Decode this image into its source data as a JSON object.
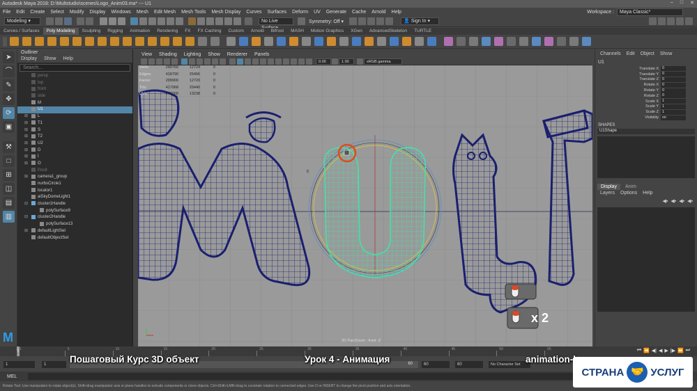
{
  "window": {
    "title": "Autodesk Maya 2018: D:\\Multstudio\\scenes\\Logo_Anim03.ma*  ---  U1",
    "controls": [
      "–",
      "□",
      "✕"
    ]
  },
  "menubar": {
    "items": [
      "File",
      "Edit",
      "Create",
      "Select",
      "Modify",
      "Display",
      "Windows",
      "Mesh",
      "Edit Mesh",
      "Mesh Tools",
      "Mesh Display",
      "Curves",
      "Surfaces",
      "Deform",
      "UV",
      "Generate",
      "Cache",
      "Arnold",
      "Help"
    ],
    "workspace_label": "Workspace :",
    "workspace_value": "Maya Classic*"
  },
  "statusline": {
    "mode": "Modeling",
    "live_surface": "No Live Surface",
    "symmetry": "Symmetry: Off",
    "signin": "Sign In"
  },
  "shelf": {
    "tabs": [
      "Curves / Surfaces",
      "Poly Modeling",
      "Sculpting",
      "Rigging",
      "Animation",
      "Rendering",
      "FX",
      "FX Caching",
      "Custom",
      "Arnold",
      "Bifrost",
      "MASH",
      "Motion Graphics",
      "XGen",
      "AdvancedSkeleton",
      "TURTLE"
    ],
    "active_tab": 1
  },
  "outliner": {
    "title": "Outliner",
    "menu": [
      "Display",
      "Show",
      "Help"
    ],
    "search_placeholder": "Search...",
    "items": [
      {
        "label": "persp",
        "dim": true,
        "exp": ""
      },
      {
        "label": "top",
        "dim": true,
        "exp": ""
      },
      {
        "label": "front",
        "dim": true,
        "exp": ""
      },
      {
        "label": "side",
        "dim": true,
        "exp": ""
      },
      {
        "label": "M",
        "dim": false,
        "exp": ""
      },
      {
        "label": "U1",
        "dim": false,
        "exp": "",
        "sel": true
      },
      {
        "label": "L",
        "dim": false,
        "exp": "⊞"
      },
      {
        "label": "T1",
        "dim": false,
        "exp": "⊞"
      },
      {
        "label": "S",
        "dim": false,
        "exp": "⊞"
      },
      {
        "label": "T2",
        "dim": false,
        "exp": "⊞"
      },
      {
        "label": "U2",
        "dim": false,
        "exp": "⊞"
      },
      {
        "label": "D",
        "dim": false,
        "exp": "⊞"
      },
      {
        "label": "I",
        "dim": false,
        "exp": "⊞"
      },
      {
        "label": "O",
        "dim": false,
        "exp": "⊞"
      },
      {
        "label": "Pos8",
        "dim": true,
        "exp": ""
      },
      {
        "label": "camera1_group",
        "dim": false,
        "exp": "⊞"
      },
      {
        "label": "nurbsCircle1",
        "dim": false,
        "exp": ""
      },
      {
        "label": "locator1",
        "dim": false,
        "exp": ""
      },
      {
        "label": "aiSkyDomeLight1",
        "dim": false,
        "exp": ""
      },
      {
        "label": "cluster1Handle",
        "dim": false,
        "exp": "⊟"
      },
      {
        "label": "polySurface9",
        "dim": false,
        "exp": "",
        "indent": true
      },
      {
        "label": "cluster2Handle",
        "dim": false,
        "exp": "⊟"
      },
      {
        "label": "polySurface13",
        "dim": false,
        "exp": "",
        "indent": true
      },
      {
        "label": "defaultLightSet",
        "dim": false,
        "exp": "⊞"
      },
      {
        "label": "defaultObjectSet",
        "dim": false,
        "exp": ""
      }
    ]
  },
  "viewport": {
    "menu": [
      "View",
      "Shading",
      "Lighting",
      "Show",
      "Renderer",
      "Panels"
    ],
    "hud": [
      [
        "Verts:",
        "249760",
        "12724",
        "0"
      ],
      [
        "Edges:",
        "418790",
        "25456",
        "0"
      ],
      [
        "Faces:",
        "209900",
        "12720",
        "0"
      ],
      [
        "Tris:",
        "417068",
        "25440",
        "0"
      ],
      [
        "UVs:",
        "278000",
        "13238",
        "0"
      ]
    ],
    "field1": "0.00",
    "field2": "1.00",
    "colorspace": "sRGB gamma",
    "pan_label": "2D Pan/Zoom : front -Z",
    "letter_c": "c"
  },
  "channelbox": {
    "menu": [
      "Channels",
      "Edit",
      "Object",
      "Show"
    ],
    "object": "U1",
    "attrs": [
      {
        "label": "Translate X",
        "value": "0"
      },
      {
        "label": "Translate Y",
        "value": "0"
      },
      {
        "label": "Translate Z",
        "value": "0"
      },
      {
        "label": "Rotate X",
        "value": "0"
      },
      {
        "label": "Rotate Y",
        "value": "0"
      },
      {
        "label": "Rotate Z",
        "value": "0"
      },
      {
        "label": "Scale X",
        "value": "1"
      },
      {
        "label": "Scale Y",
        "value": "1"
      },
      {
        "label": "Scale Z",
        "value": "1"
      },
      {
        "label": "Visibility",
        "value": "on"
      }
    ],
    "shapes_header": "SHAPES",
    "shape_name": "U1Shape",
    "layer_tabs": [
      "Display",
      "Anim"
    ],
    "layer_menu": [
      "Layers",
      "Options",
      "Help"
    ]
  },
  "timeline": {
    "ticks": [
      "1",
      "5",
      "10",
      "15",
      "20",
      "25",
      "30",
      "35",
      "40",
      "45",
      "50",
      "55"
    ],
    "current_frame": "2"
  },
  "range": {
    "start": "1",
    "start2": "1",
    "end_inner": "60",
    "end1": "60",
    "end2": "60",
    "no_character_set": "No Character Set"
  },
  "mel": {
    "label": "MEL"
  },
  "helpline": "Rotate Tool: Use manipulator to rotate object(s). Shift+drag manipulator axis or plane handles to extrude components or clone objects. Ctrl+Shift+LMB+drag to constrain rotation to connected edges. Use D or INSERT to change the pivot position and axis orientation.",
  "overlay": {
    "left_caption": "Пошаговый Курс 3D объект",
    "center_caption": "Урок 4 - Анимация",
    "right_caption": "animation-l",
    "mouse_multiplier": "x 2",
    "brand_left": "СТРАНА",
    "brand_right": "УСЛУГ"
  },
  "colors": {
    "accent": "#5285a6",
    "wire_blue": "#1a1f6e",
    "wire_green": "#3fe5a8",
    "viewport_bg": "#9a9a9a"
  }
}
